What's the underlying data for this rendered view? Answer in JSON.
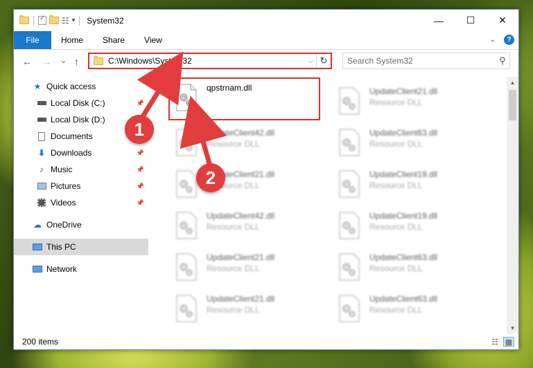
{
  "window": {
    "title": "System32",
    "controls": {
      "minimize": "—",
      "maximize": "☐",
      "close": "✕"
    }
  },
  "ribbon": {
    "file_tab": "File",
    "tabs": [
      "Home",
      "Share",
      "View"
    ],
    "help": "?"
  },
  "address": {
    "path": "C:\\Windows\\System32",
    "refresh": "↻",
    "dropdown": "⌵"
  },
  "search": {
    "placeholder": "Search System32"
  },
  "nav": {
    "back": "←",
    "forward": "→",
    "recent": "⌄",
    "up": "↑",
    "items": [
      {
        "label": "Quick access",
        "icon": "star-icon"
      },
      {
        "label": "Local Disk (C:)",
        "icon": "drive-icon"
      },
      {
        "label": "Local Disk (D:)",
        "icon": "drive-icon"
      },
      {
        "label": "Documents",
        "icon": "documents-icon"
      },
      {
        "label": "Downloads",
        "icon": "download-icon"
      },
      {
        "label": "Music",
        "icon": "music-icon"
      },
      {
        "label": "Pictures",
        "icon": "pictures-icon"
      },
      {
        "label": "Videos",
        "icon": "videos-icon"
      },
      {
        "label": "OneDrive",
        "icon": "cloud-icon"
      },
      {
        "label": "This PC",
        "icon": "computer-icon"
      },
      {
        "label": "Network",
        "icon": "network-icon"
      }
    ]
  },
  "files": [
    {
      "name": "qpstrnam.dll",
      "type": ""
    },
    {
      "name": "UpdateClient21.dll",
      "type": "Resource DLL"
    },
    {
      "name": "UpdateClient42.dll",
      "type": "Resource DLL"
    },
    {
      "name": "UpdateClient63.dll",
      "type": "Resource DLL"
    },
    {
      "name": "UpdateClient21.dll",
      "type": "Resource DLL"
    },
    {
      "name": "UpdateClient19.dll",
      "type": "Resource DLL"
    },
    {
      "name": "UpdateClient42.dll",
      "type": "Resource DLL"
    },
    {
      "name": "UpdateClient19.dll",
      "type": "Resource DLL"
    },
    {
      "name": "UpdateClient21.dll",
      "type": "Resource DLL"
    },
    {
      "name": "UpdateClient63.dll",
      "type": "Resource DLL"
    },
    {
      "name": "UpdateClient21.dll",
      "type": "Resource DLL"
    },
    {
      "name": "UpdateClient63.dll",
      "type": "Resource DLL"
    }
  ],
  "status": {
    "count": "200 items"
  },
  "annotations": {
    "badge1": "1",
    "badge2": "2"
  },
  "colors": {
    "accent": "#1979ca",
    "highlight": "#e02d2d",
    "badge": "#e23d3d"
  }
}
